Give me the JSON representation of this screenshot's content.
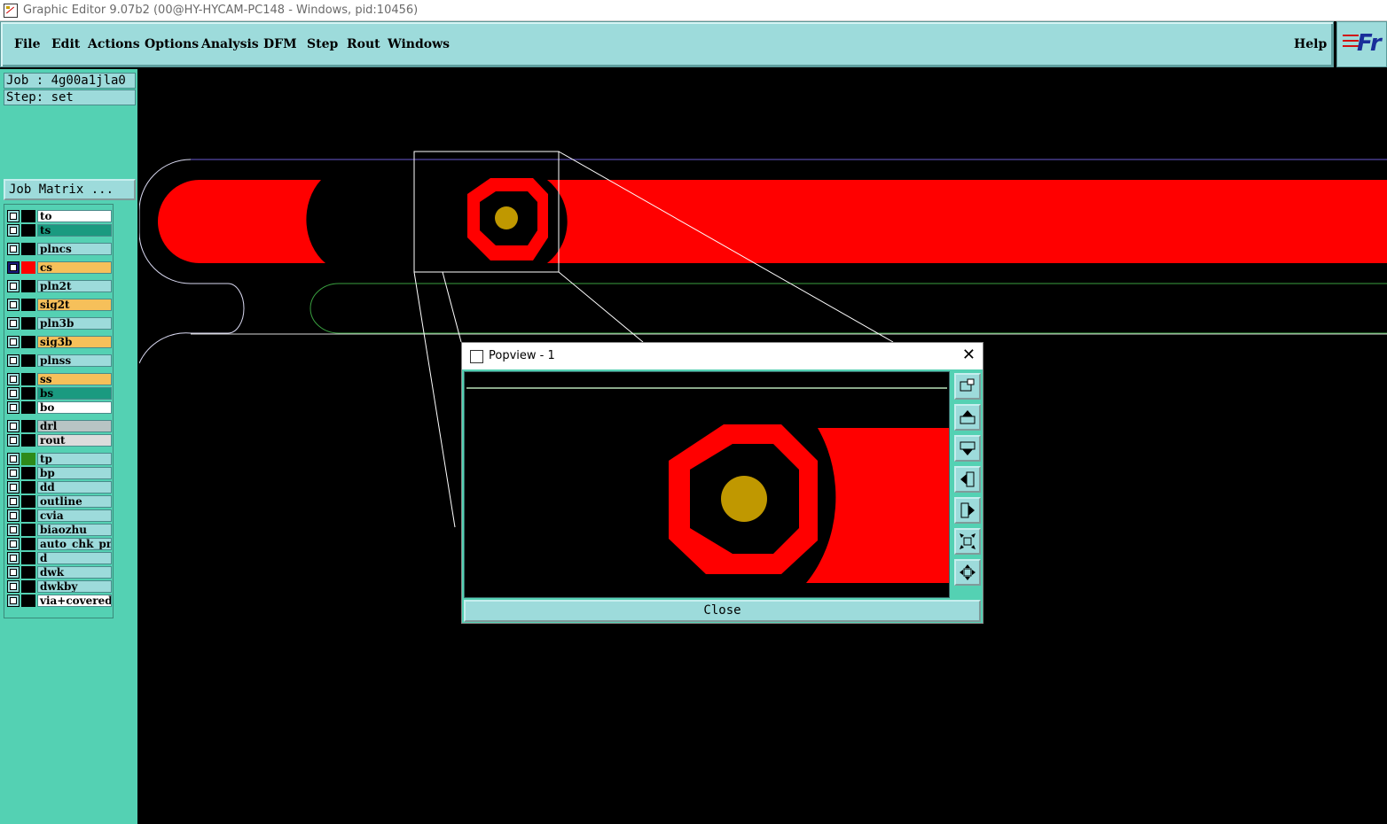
{
  "window": {
    "title": "Graphic Editor 9.07b2 (00@HY-HYCAM-PC148 - Windows, pid:10456)"
  },
  "menu": {
    "items": [
      "File",
      "Edit",
      "Actions",
      "Options",
      "Analysis",
      "DFM",
      "Step",
      "Rout",
      "Windows"
    ],
    "help": "Help",
    "logo": "Fr"
  },
  "job": {
    "job_label": "Job : 4g00a1jla0",
    "step_label": "Step: set",
    "matrix_button": "Job Matrix ..."
  },
  "layers": [
    {
      "name": "to",
      "color": "#ffffff"
    },
    {
      "name": "ts",
      "color": "#1a9a80"
    },
    {
      "name": "plncs",
      "color": "#9ddbdb"
    },
    {
      "name": "cs",
      "color": "#f6c05a",
      "active": true,
      "swatch": "#ff0000"
    },
    {
      "name": "pln2t",
      "color": "#9ddbdb"
    },
    {
      "name": "sig2t",
      "color": "#f6c05a"
    },
    {
      "name": "pln3b",
      "color": "#9ddbdb"
    },
    {
      "name": "sig3b",
      "color": "#f6c05a"
    },
    {
      "name": "plnss",
      "color": "#9ddbdb"
    },
    {
      "name": "ss",
      "color": "#f6c05a"
    },
    {
      "name": "bs",
      "color": "#1a9a80"
    },
    {
      "name": "bo",
      "color": "#ffffff"
    },
    {
      "name": "drl",
      "color": "#b8c4c4"
    },
    {
      "name": "rout",
      "color": "#dcdcdc"
    },
    {
      "name": "tp",
      "color": "#9ddbdb",
      "swatch": "#2e8a1a"
    },
    {
      "name": "bp",
      "color": "#9ddbdb"
    },
    {
      "name": "dd",
      "color": "#9ddbdb"
    },
    {
      "name": "outline",
      "color": "#9ddbdb"
    },
    {
      "name": "cvia",
      "color": "#9ddbdb"
    },
    {
      "name": "biaozhu",
      "color": "#9ddbdb"
    },
    {
      "name": "auto_chk_pn",
      "color": "#9ddbdb"
    },
    {
      "name": "d",
      "color": "#9ddbdb"
    },
    {
      "name": "dwk",
      "color": "#9ddbdb"
    },
    {
      "name": "dwkby",
      "color": "#9ddbdb"
    },
    {
      "name": "via+covered",
      "color": "#ffffff"
    }
  ],
  "popview": {
    "title": "Popview - 1",
    "close_label": "Close"
  },
  "colors": {
    "trace": "#ff0000",
    "pad": "#c09800",
    "panel": "#54d1b3",
    "menu": "#9ddbdb"
  }
}
